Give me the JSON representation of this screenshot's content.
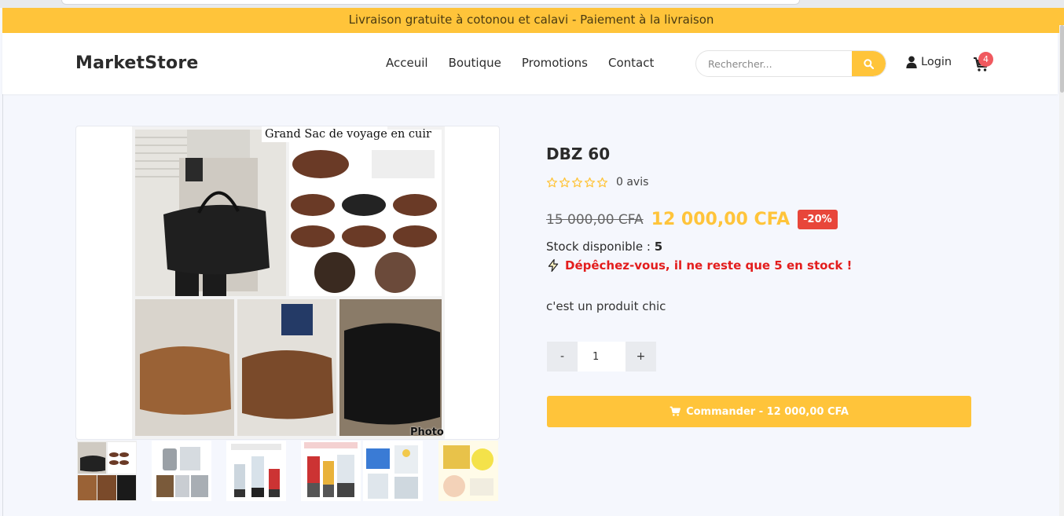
{
  "announcement": "Livraison gratuite à cotonou et calavi - Paiement à la livraison",
  "header": {
    "logo": "MarketStore",
    "nav": [
      "Acceuil",
      "Boutique",
      "Promotions",
      "Contact"
    ],
    "search_placeholder": "Rechercher...",
    "login_label": "Login",
    "cart_count": "4"
  },
  "gallery": {
    "main_image_title": "Grand Sac de voyage en cuir",
    "main_image_tag": "Photo",
    "thumbnail_count": 6
  },
  "product": {
    "title": "DBZ 60",
    "reviews": "0 avis",
    "rating_stars": 0,
    "old_price": "15 000,00 CFA",
    "new_price": "12 000,00 CFA",
    "discount": "-20%",
    "stock_label": "Stock disponible :",
    "stock_value": "5",
    "hurry_message": "Dépêchez-vous, il ne reste que 5 en stock !",
    "description": "c'est un produit chic",
    "quantity": "1",
    "qty_minus": "-",
    "qty_plus": "+",
    "order_button": "Commander - 12 000,00 CFA"
  },
  "colors": {
    "accent": "#ffc43a",
    "badge": "#f0595f",
    "discount": "#e8463a",
    "urgent": "#e31d1d"
  }
}
